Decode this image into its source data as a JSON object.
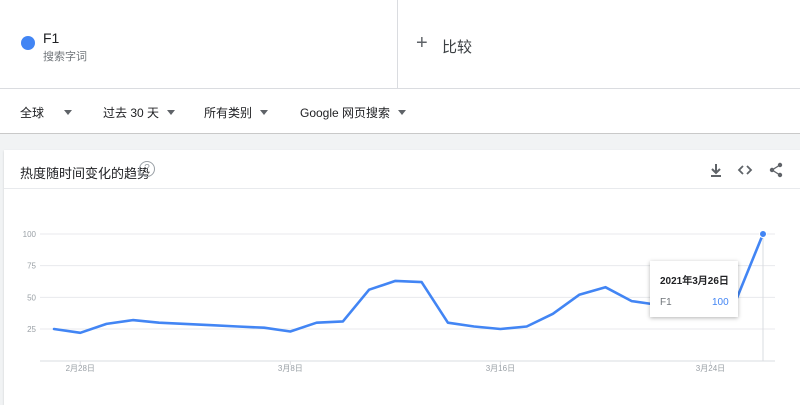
{
  "term": {
    "name": "F1",
    "subtitle": "搜索字词",
    "color": "#4285f4"
  },
  "compare": {
    "plus": "+",
    "label": "比较"
  },
  "filters": [
    {
      "label": "全球"
    },
    {
      "label": "过去 30 天"
    },
    {
      "label": "所有类别"
    },
    {
      "label": "Google 网页搜索"
    }
  ],
  "card": {
    "title": "热度随时间变化的趋势",
    "help": "?"
  },
  "icons": [
    "download-icon",
    "embed-code-icon",
    "share-icon"
  ],
  "tooltip": {
    "date": "2021年3月26日",
    "term": "F1",
    "value": "100"
  },
  "chart_data": {
    "type": "line",
    "y_ticks": [
      25,
      50,
      75,
      100
    ],
    "ylim": [
      0,
      100
    ],
    "x_ticks": [
      "2月28日",
      "3月8日",
      "3月16日",
      "3月24日"
    ],
    "grid": true,
    "series": [
      {
        "name": "F1",
        "color": "#4285f4",
        "x": [
          "2月27日",
          "2月28日",
          "3月1日",
          "3月2日",
          "3月3日",
          "3月4日",
          "3月5日",
          "3月6日",
          "3月7日",
          "3月8日",
          "3月9日",
          "3月10日",
          "3月11日",
          "3月12日",
          "3月13日",
          "3月14日",
          "3月15日",
          "3月16日",
          "3月17日",
          "3月18日",
          "3月19日",
          "3月20日",
          "3月21日",
          "3月22日",
          "3月23日",
          "3月24日",
          "3月25日",
          "3月26日"
        ],
        "values": [
          25,
          22,
          29,
          32,
          30,
          29,
          28,
          27,
          26,
          23,
          30,
          31,
          56,
          63,
          62,
          30,
          27,
          25,
          27,
          37,
          52,
          58,
          47,
          44,
          43,
          44,
          49,
          100
        ]
      }
    ]
  }
}
